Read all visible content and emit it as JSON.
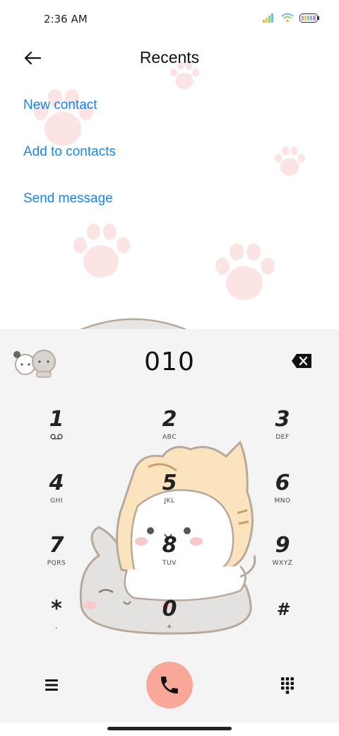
{
  "status_bar": {
    "time": "2:36 AM"
  },
  "header": {
    "title": "Recents"
  },
  "actions": {
    "new_contact": "New contact",
    "add_to_contacts": "Add to contacts",
    "send_message": "Send message"
  },
  "dialer": {
    "number": "010",
    "keys": [
      {
        "digit": "1",
        "sub": "voicemail-icon"
      },
      {
        "digit": "2",
        "sub": "ABC"
      },
      {
        "digit": "3",
        "sub": "DEF"
      },
      {
        "digit": "4",
        "sub": "GHI"
      },
      {
        "digit": "5",
        "sub": "JKL"
      },
      {
        "digit": "6",
        "sub": "MNO"
      },
      {
        "digit": "7",
        "sub": "PQRS"
      },
      {
        "digit": "8",
        "sub": "TUV"
      },
      {
        "digit": "9",
        "sub": "WXYZ"
      },
      {
        "digit": "*",
        "sub": ","
      },
      {
        "digit": "0",
        "sub": "+"
      },
      {
        "digit": "#",
        "sub": ""
      }
    ]
  },
  "colors": {
    "accent": "#1a85e6",
    "call_button": "#f9a798",
    "panel_bg": "#f4f4f4",
    "paw": "#fde4e4"
  },
  "icons": {
    "back": "arrow-left-icon",
    "backspace": "backspace-icon",
    "menu": "hamburger-icon",
    "call": "phone-icon",
    "keypad": "dialpad-icon"
  }
}
